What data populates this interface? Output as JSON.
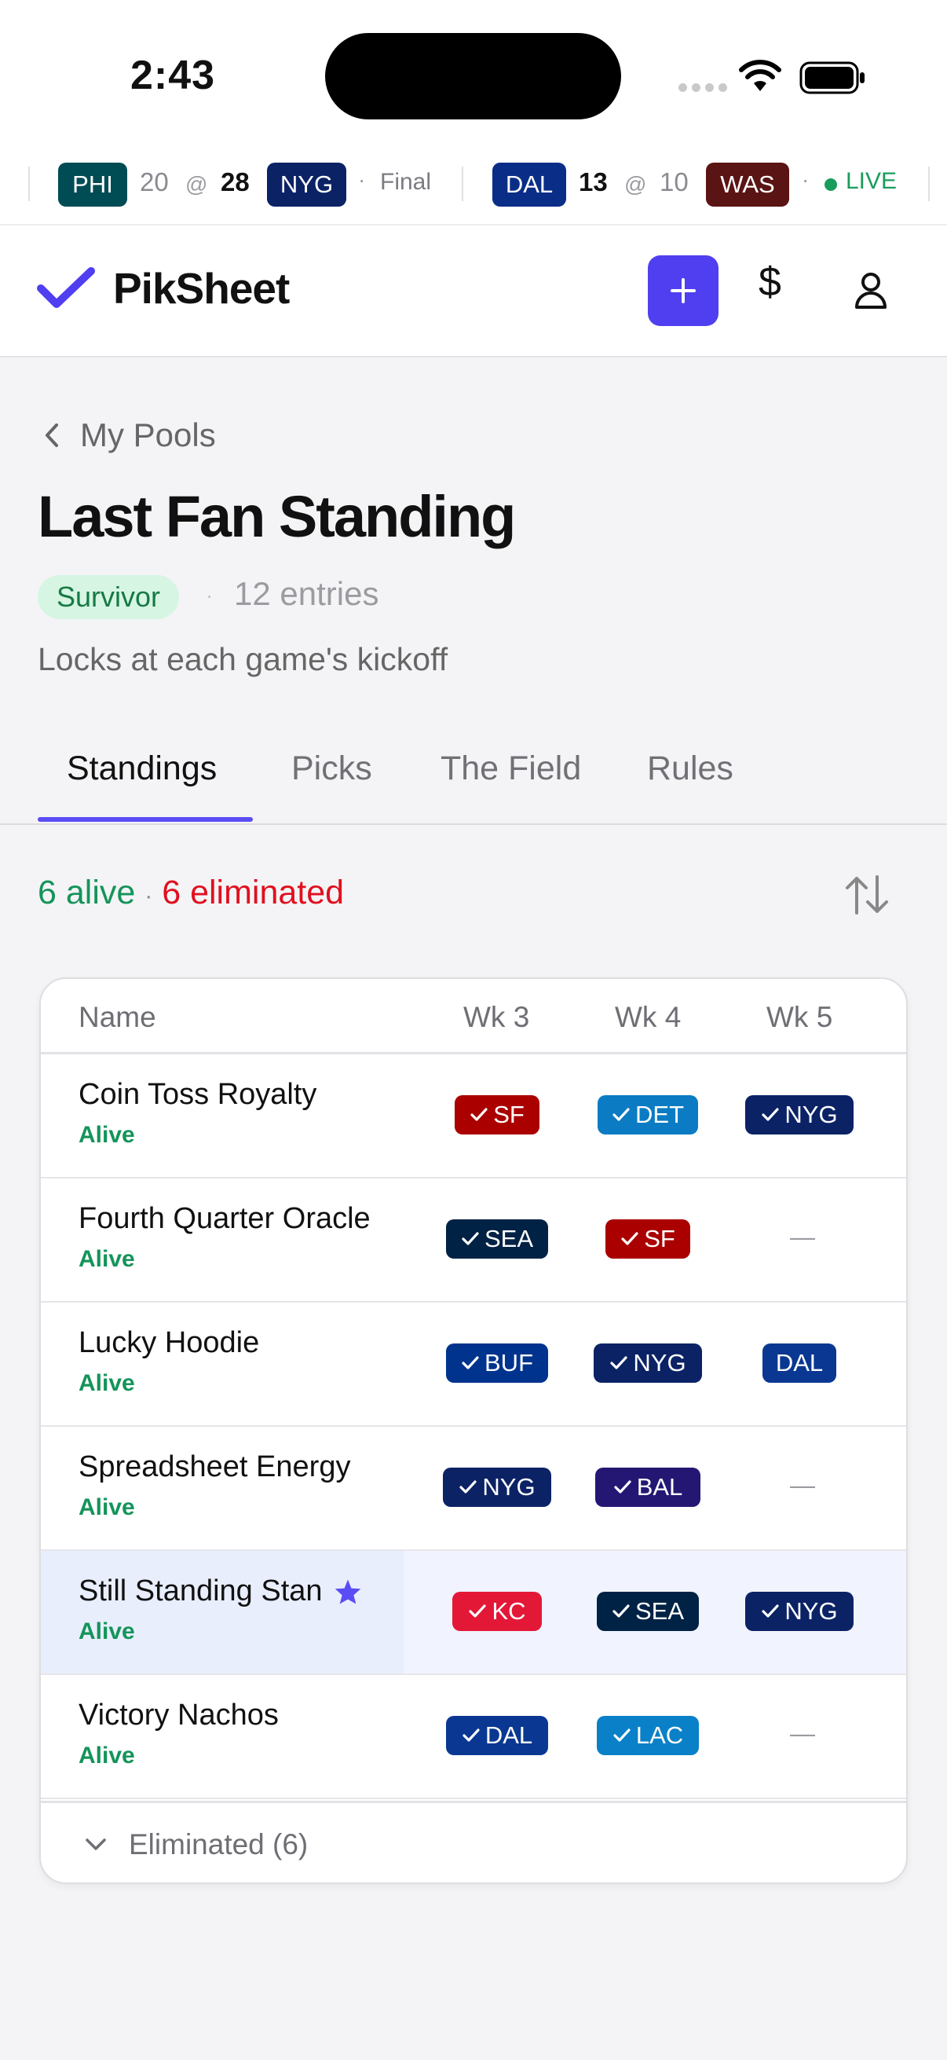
{
  "status_bar": {
    "time": "2:43"
  },
  "ticker": {
    "games": [
      {
        "away": "PHI",
        "away_score": "20",
        "at": "@",
        "home_score": "28",
        "home": "NYG",
        "status": "Final",
        "away_color": "#004c54",
        "home_color": "#0b2265"
      },
      {
        "away": "DAL",
        "away_score": "13",
        "at": "@",
        "home_score": "10",
        "home": "WAS",
        "status": "LIVE",
        "away_color": "#0a2e88",
        "home_color": "#5a1414"
      }
    ]
  },
  "header": {
    "brand": "PikSheet",
    "accent": "#4f3ff0",
    "dollar_label": "$"
  },
  "page": {
    "back_label": "My Pools",
    "title": "Last Fan Standing",
    "type": "Survivor",
    "entries": "12 entries",
    "subtitle": "Locks at each game's kickoff"
  },
  "tabs": [
    "Standings",
    "Picks",
    "The Field",
    "Rules"
  ],
  "summary": {
    "alive": "6 alive",
    "eliminated": "6 eliminated",
    "sep": "·"
  },
  "table": {
    "columns": [
      "Name",
      "Wk 3",
      "Wk 4",
      "Wk 5"
    ],
    "rows": [
      {
        "name": "Coin Toss Royalty",
        "status": "Alive",
        "picks": [
          {
            "team": "SF",
            "check": true,
            "color": "#aa0000"
          },
          {
            "team": "DET",
            "check": true,
            "color": "#0b7cc3"
          },
          {
            "team": "NYG",
            "check": true,
            "color": "#0b2265"
          }
        ]
      },
      {
        "name": "Fourth Quarter Oracle",
        "status": "Alive",
        "picks": [
          {
            "team": "SEA",
            "check": true,
            "color": "#002244"
          },
          {
            "team": "SF",
            "check": true,
            "color": "#aa0000"
          },
          {
            "team": "—",
            "check": false,
            "color": ""
          }
        ]
      },
      {
        "name": "Lucky Hoodie",
        "status": "Alive",
        "picks": [
          {
            "team": "BUF",
            "check": true,
            "color": "#00338d"
          },
          {
            "team": "NYG",
            "check": true,
            "color": "#0b2265"
          },
          {
            "team": "DAL",
            "check": false,
            "color": "#0a3791"
          }
        ]
      },
      {
        "name": "Spreadsheet Energy",
        "status": "Alive",
        "picks": [
          {
            "team": "NYG",
            "check": true,
            "color": "#0b2265"
          },
          {
            "team": "BAL",
            "check": true,
            "color": "#241773"
          },
          {
            "team": "—",
            "check": false,
            "color": ""
          }
        ]
      },
      {
        "name": "Still Standing Stan",
        "status": "Alive",
        "highlight": true,
        "picks": [
          {
            "team": "KC",
            "check": true,
            "color": "#e31837"
          },
          {
            "team": "SEA",
            "check": true,
            "color": "#002244"
          },
          {
            "team": "NYG",
            "check": true,
            "color": "#0b2265"
          }
        ]
      },
      {
        "name": "Victory Nachos",
        "status": "Alive",
        "picks": [
          {
            "team": "DAL",
            "check": true,
            "color": "#0a3791"
          },
          {
            "team": "LAC",
            "check": true,
            "color": "#0a80c8"
          },
          {
            "team": "—",
            "check": false,
            "color": ""
          }
        ]
      }
    ],
    "eliminated_toggle": "Eliminated (6)"
  }
}
